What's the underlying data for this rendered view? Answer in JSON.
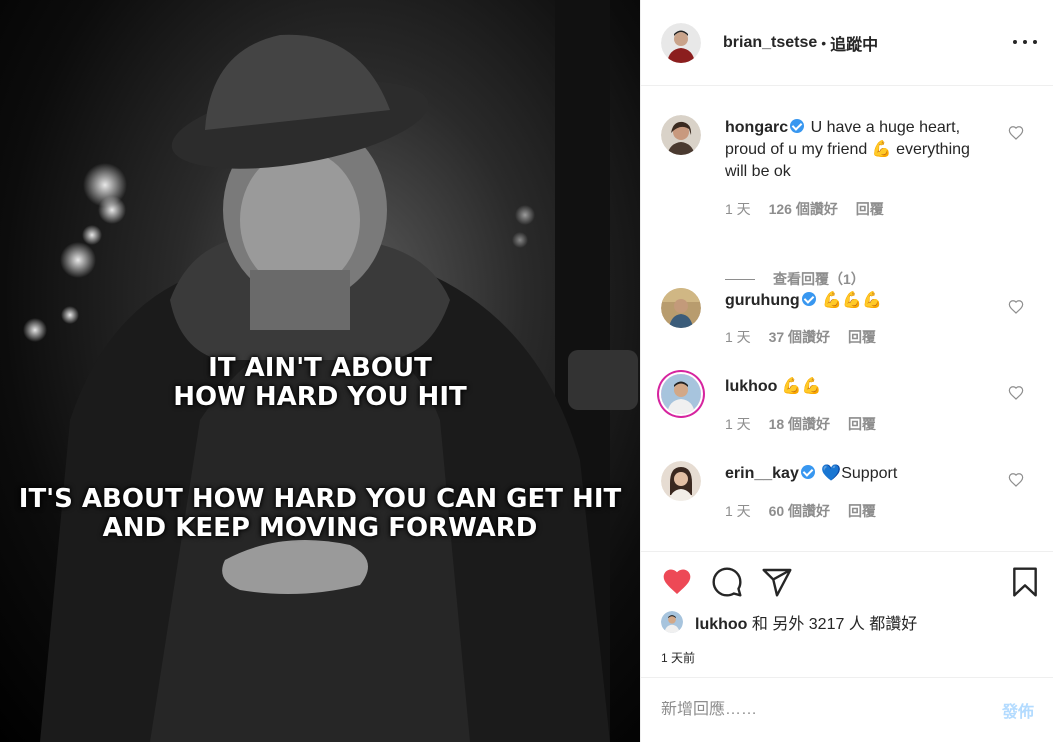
{
  "photo": {
    "quote_line_1": "IT AIN'T ABOUT",
    "quote_line_2": "HOW HARD YOU HIT",
    "quote_line_3": "IT'S ABOUT HOW HARD YOU CAN GET HIT",
    "quote_line_4": "AND KEEP MOVING FORWARD"
  },
  "header": {
    "username": "brian_tsetse",
    "separator": "•",
    "follow_status": "追蹤中"
  },
  "comments": [
    {
      "username": "hongarc",
      "text": "U have a huge heart, proud of u my friend 💪 everything will be ok",
      "time": "1 天",
      "likes": "126 個讚好",
      "reply": "回覆",
      "view_replies": "查看回覆（1）"
    },
    {
      "username": "guruhung",
      "text": "💪💪💪",
      "time": "1 天",
      "likes": "37 個讚好",
      "reply": "回覆"
    },
    {
      "username": "lukhoo",
      "text": "💪💪",
      "time": "1 天",
      "likes": "18 個讚好",
      "reply": "回覆"
    },
    {
      "username": "erin__kay",
      "text": "💙Support",
      "time": "1 天",
      "likes": "60 個讚好",
      "reply": "回覆"
    }
  ],
  "likes_summary": {
    "user": "lukhoo",
    "rest": "和 另外 3217 人 都讚好"
  },
  "time_ago": "1 天前",
  "add_comment": {
    "placeholder": "新增回應……",
    "post_label": "發佈"
  },
  "colors": {
    "heart_red": "#ed4956",
    "verified_blue": "#3897f0",
    "post_disabled": "#b3dbff"
  }
}
